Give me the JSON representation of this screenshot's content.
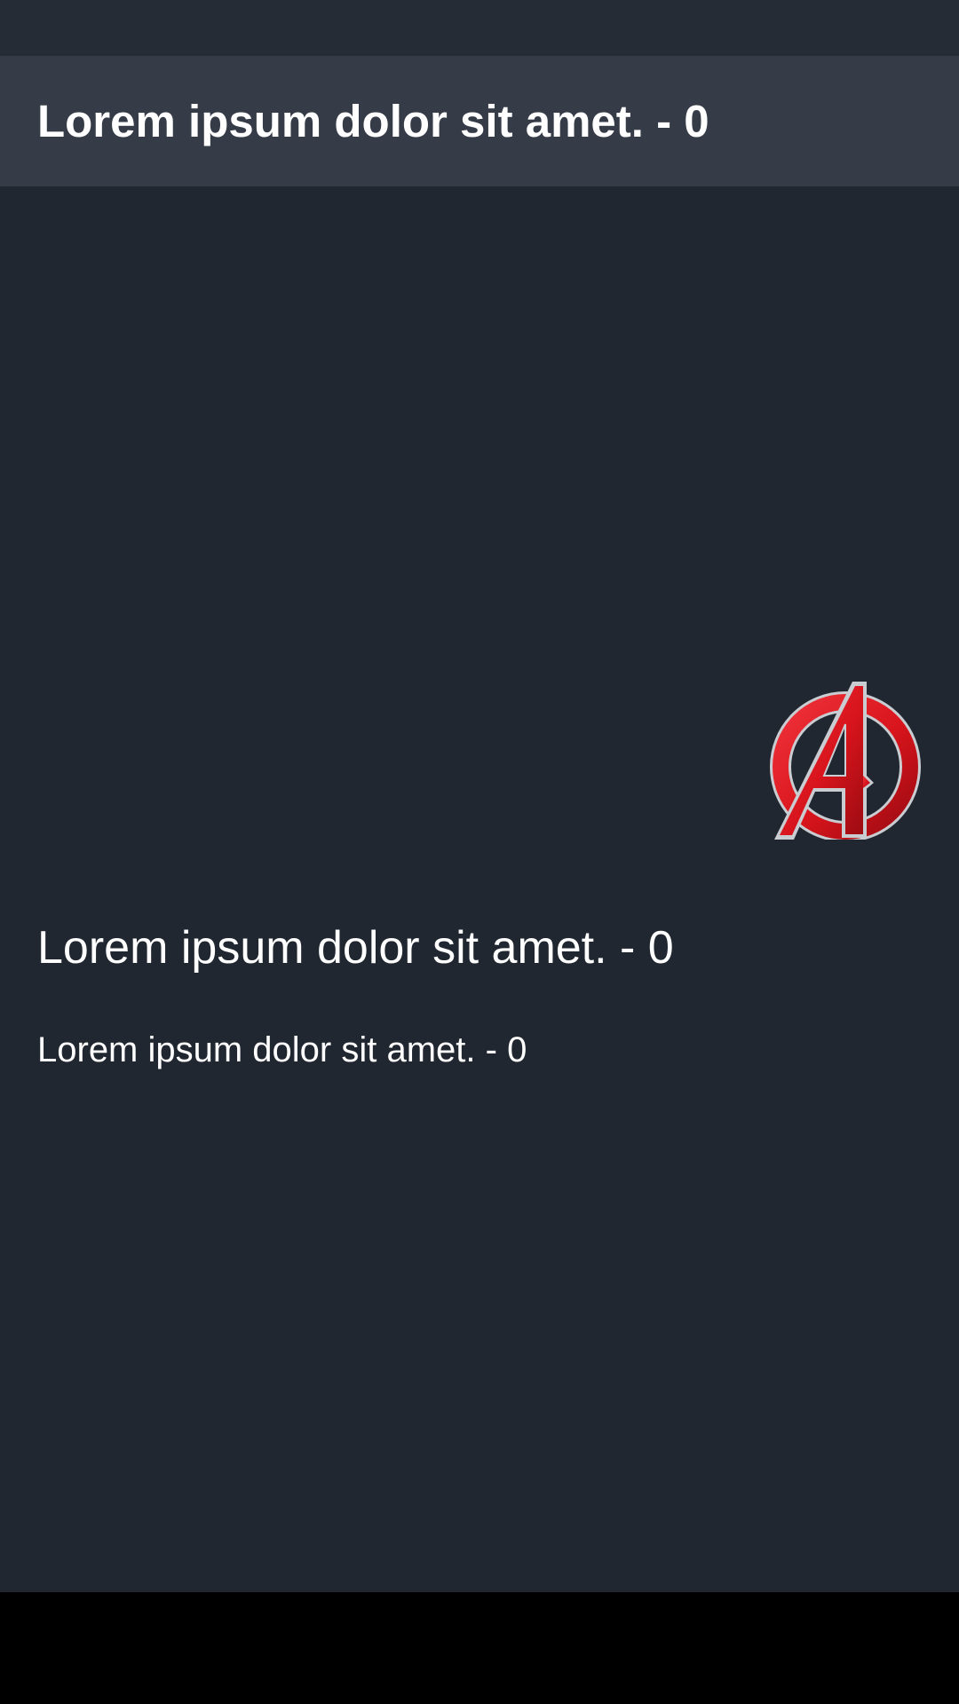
{
  "app_bar": {
    "title": "Lorem ipsum dolor sit amet. - 0"
  },
  "main": {
    "logo": {
      "icon": "avengers-logo-icon",
      "primary_color": "#d8141c",
      "outline_color": "#c9ccd1"
    },
    "headline": "Lorem ipsum dolor sit amet. - 0",
    "subline": "Lorem ipsum dolor sit amet. - 0"
  },
  "colors": {
    "status_bar": "#262c36",
    "app_bar": "#353b47",
    "background": "#212730",
    "navigation_bar": "#000000",
    "text": "#ffffff"
  }
}
